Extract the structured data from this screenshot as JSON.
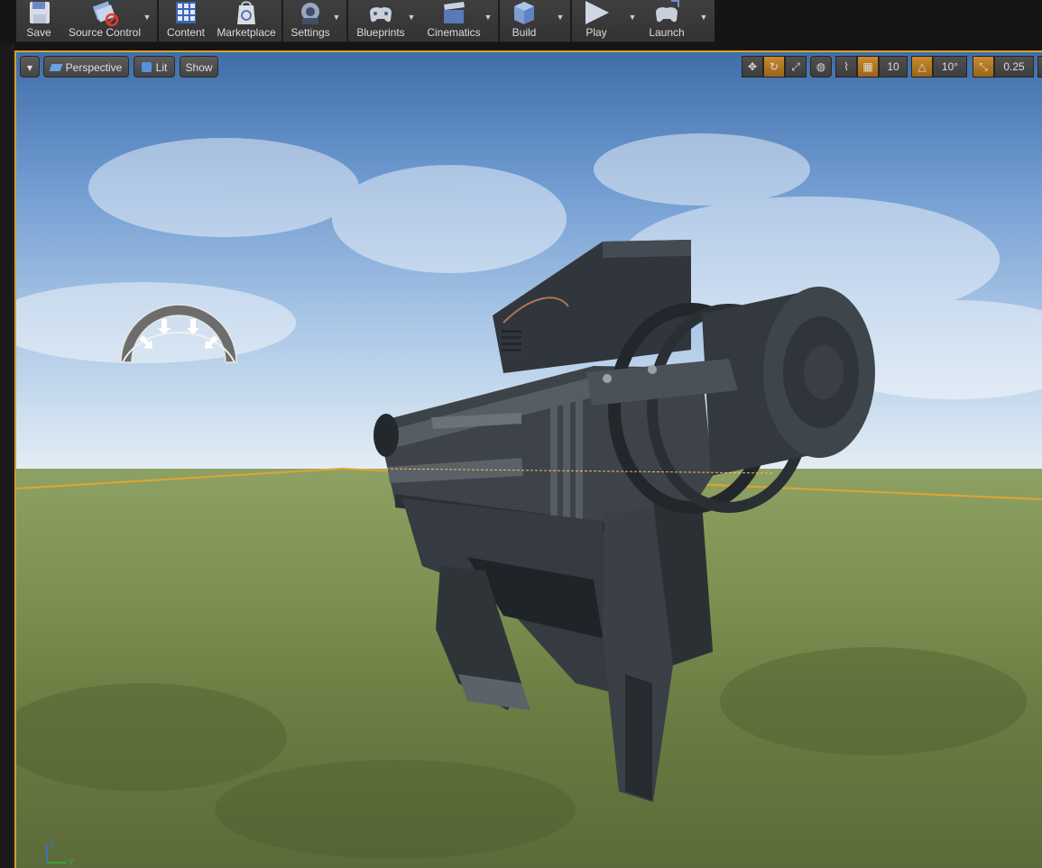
{
  "toolbar": {
    "buttons": [
      {
        "label": "Save",
        "icon": "floppy-icon"
      },
      {
        "label": "Source Control",
        "icon": "source-control-icon"
      },
      {
        "label": "Content",
        "icon": "content-icon"
      },
      {
        "label": "Marketplace",
        "icon": "marketplace-icon"
      },
      {
        "label": "Settings",
        "icon": "gear-icon"
      },
      {
        "label": "Blueprints",
        "icon": "gamepad-icon"
      },
      {
        "label": "Cinematics",
        "icon": "clapper-icon"
      },
      {
        "label": "Build",
        "icon": "cubes-icon"
      },
      {
        "label": "Play",
        "icon": "play-icon"
      },
      {
        "label": "Launch",
        "icon": "launch-icon"
      }
    ]
  },
  "viewport": {
    "view_mode": "Perspective",
    "lighting": "Lit",
    "show": "Show",
    "grid_snap": "10",
    "rotation_snap": "10°",
    "scale_snap": "0.25",
    "axis_labels": {
      "z": "Z",
      "y": "Y"
    }
  },
  "colors": {
    "selection_outline": "#d9a12a",
    "active_toggle": "#c88a2e"
  }
}
